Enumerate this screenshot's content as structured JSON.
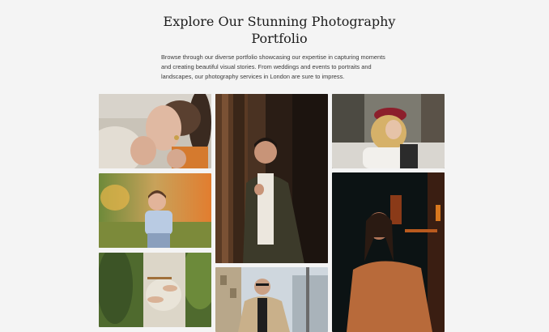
{
  "section": {
    "title": "Explore Our Stunning Photography Portfolio",
    "description": "Browse through our diverse portfolio showcasing our expertise in capturing moments and creating beautiful visual stories. From weddings and events to portraits and landscapes, our photography services in London are sure to impress."
  },
  "gallery": {
    "photos": [
      {
        "subject": "woman-reclining-portrait"
      },
      {
        "subject": "man-doorway-portrait"
      },
      {
        "subject": "woman-red-beret-portrait"
      },
      {
        "subject": "boy-in-field"
      },
      {
        "subject": "woman-night-portrait"
      },
      {
        "subject": "pregnant-woman-maternity"
      },
      {
        "subject": "man-street-portrait"
      }
    ]
  }
}
